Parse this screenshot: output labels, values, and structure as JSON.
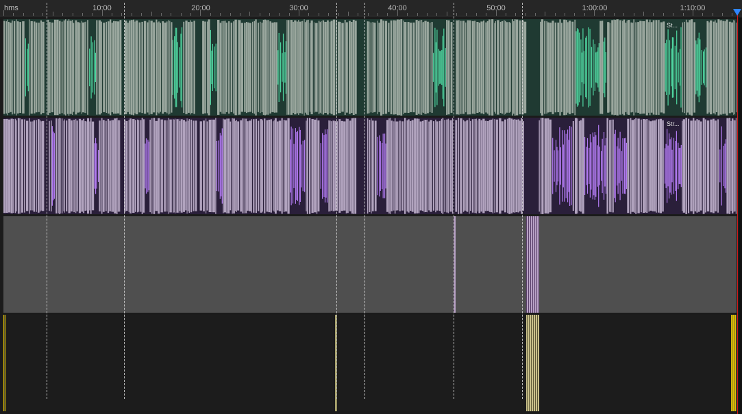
{
  "ruler": {
    "unit_label": "hms",
    "labels": [
      "10:00",
      "20:00",
      "30:00",
      "40:00",
      "50:00",
      "1:00:00",
      "1:10:00"
    ]
  },
  "tracks": [
    {
      "name": "track-1-green",
      "clip_label": "St...",
      "fill": "#9aa79e",
      "wave": "#4fd5a0",
      "dark": "#1f3a32"
    },
    {
      "name": "track-2-purple",
      "clip_label": "Str...",
      "fill": "#b1a3be",
      "wave": "#b17af0",
      "dark": "#2a1f3a"
    },
    {
      "name": "track-3-gray",
      "clip_label": "",
      "fill": "#4f4f4f",
      "wave": "#c6a3d6",
      "dark": "#3e3e3e"
    },
    {
      "name": "track-4-dark",
      "clip_label": "",
      "fill": "#1c1c1c",
      "wave": "#ffd400",
      "dark": "#1c1c1c"
    }
  ],
  "colors": {
    "playhead": "#d01818",
    "playhead_head": "#2f86ff",
    "marker": "#d8d8d8"
  },
  "icons": {
    "playhead_head": "playhead-triangle-icon"
  }
}
